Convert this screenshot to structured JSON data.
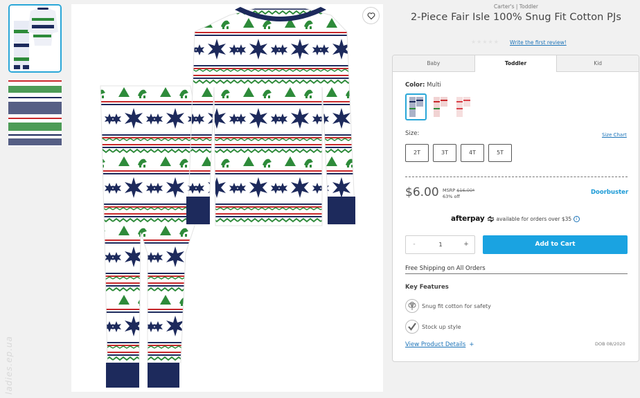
{
  "product": {
    "brand_line": "Carter's | Toddler",
    "title": "2-Piece Fair Isle 100% Snug Fit Cotton PJs",
    "review_link": "Write the first review!"
  },
  "tabs": [
    {
      "label": "Baby",
      "active": false
    },
    {
      "label": "Toddler",
      "active": true
    },
    {
      "label": "Kid",
      "active": false
    }
  ],
  "color": {
    "label": "Color:",
    "value": "Multi",
    "swatches": [
      "multi-navy",
      "multi-red",
      "multi-pink"
    ]
  },
  "size": {
    "label": "Size:",
    "chart_link": "Size Chart",
    "options": [
      "2T",
      "3T",
      "4T",
      "5T"
    ]
  },
  "pricing": {
    "price": "$6.00",
    "msrp_label": "MSRP",
    "msrp_value": "$16.00*",
    "discount": "63% off",
    "doorbuster": "Doorbuster"
  },
  "afterpay": {
    "brand": "afterpay",
    "text": "available for orders over $35",
    "info": "i"
  },
  "cart": {
    "minus": "-",
    "quantity": "1",
    "plus": "+",
    "add_label": "Add to Cart"
  },
  "shipping": "Free Shipping on All Orders",
  "key_features": {
    "heading": "Key Features",
    "items": [
      {
        "text": "Snug fit cotton for safety",
        "icon": "cotton-icon"
      },
      {
        "text": "Stock up style",
        "icon": "check-icon"
      }
    ]
  },
  "details": {
    "link": "View Product Details",
    "plus": "+",
    "dob": "DOB 08/2020"
  },
  "watermark": "ladies.ep.ua",
  "colors": {
    "accent": "#1aa3e1",
    "link": "#1b73b8",
    "navy": "#1d2a5c",
    "green": "#2e8b3a",
    "red": "#c8282b"
  }
}
